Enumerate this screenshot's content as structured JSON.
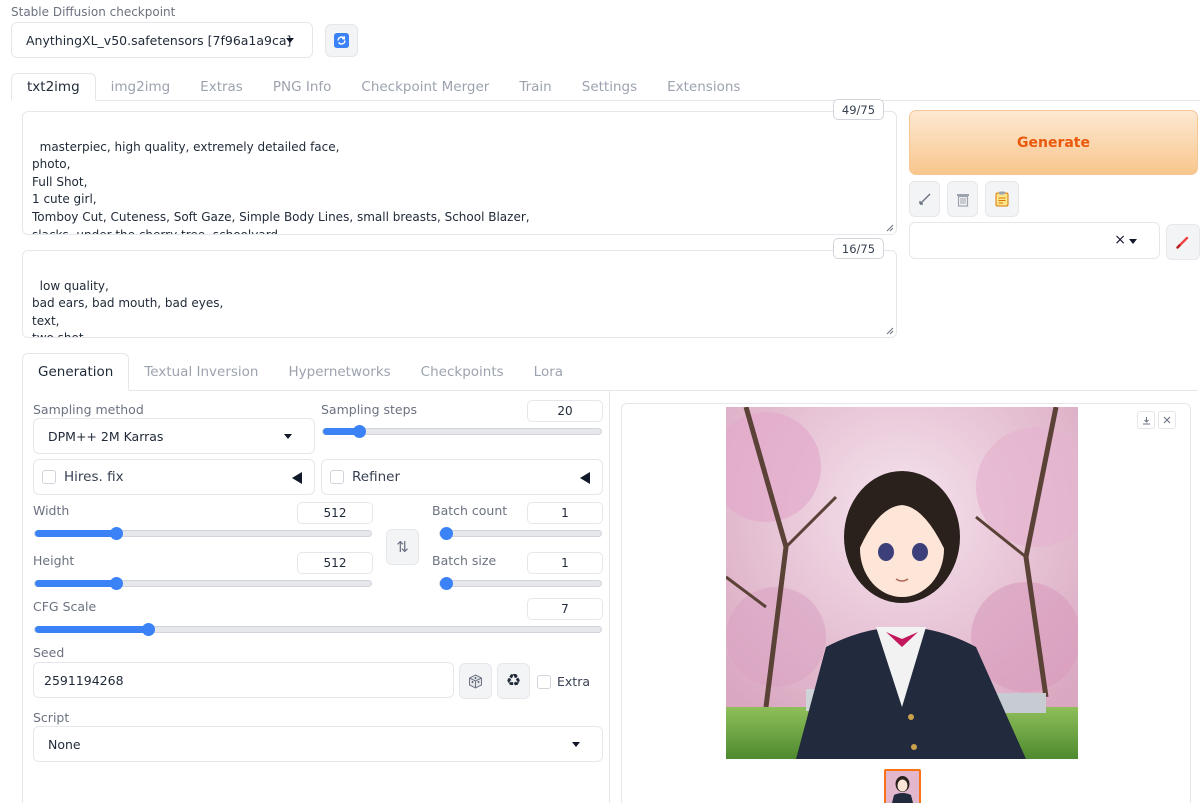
{
  "checkpoint": {
    "label": "Stable Diffusion checkpoint",
    "value": "AnythingXL_v50.safetensors [7f96a1a9ca]",
    "refresh_icon": "refresh-icon"
  },
  "main_tabs": [
    "txt2img",
    "img2img",
    "Extras",
    "PNG Info",
    "Checkpoint Merger",
    "Train",
    "Settings",
    "Extensions"
  ],
  "prompt": {
    "counter": "49/75",
    "text": "masterpiec, high quality, extremely detailed face,\nphoto,\nFull Shot,\n1 cute girl,\nTomboy Cut, Cuteness, Soft Gaze, Simple Body Lines, small breasts, School Blazer,\nslacks, under the cherry tree, schoolyard"
  },
  "negative_prompt": {
    "counter": "16/75",
    "text": "low quality,\nbad ears, bad mouth, bad eyes,\ntext,\ntwo shot"
  },
  "generate_label": "Generate",
  "tool_icons": [
    "arrow-icon",
    "trash-icon",
    "clipboard-icon"
  ],
  "styles": {
    "value": "",
    "clear_icon": "×",
    "edit_icon": "brush-icon"
  },
  "sub_tabs": [
    "Generation",
    "Textual Inversion",
    "Hypernetworks",
    "Checkpoints",
    "Lora"
  ],
  "sampling": {
    "method_label": "Sampling method",
    "method_value": "DPM++ 2M Karras",
    "steps_label": "Sampling steps",
    "steps_value": "20",
    "steps_fraction": 0.13
  },
  "hires_label": "Hires. fix",
  "refiner_label": "Refiner",
  "width": {
    "label": "Width",
    "value": "512",
    "fraction": 0.24
  },
  "height": {
    "label": "Height",
    "value": "512",
    "fraction": 0.24
  },
  "swap_icon": "⇅",
  "batch_count": {
    "label": "Batch count",
    "value": "1",
    "fraction": 0.0
  },
  "batch_size": {
    "label": "Batch size",
    "value": "1",
    "fraction": 0.0
  },
  "cfg": {
    "label": "CFG Scale",
    "value": "7",
    "fraction": 0.2
  },
  "seed": {
    "label": "Seed",
    "value": "2591194268",
    "extra_label": "Extra",
    "recycle_icon": "♻"
  },
  "script": {
    "label": "Script",
    "value": "None"
  },
  "output_icons": [
    "download-icon",
    "close-icon"
  ],
  "colors": {
    "accent": "#3b82f6",
    "generate_start": "#fde3c6",
    "generate_end": "#f9c98f",
    "generate_text": "#ea580c"
  }
}
